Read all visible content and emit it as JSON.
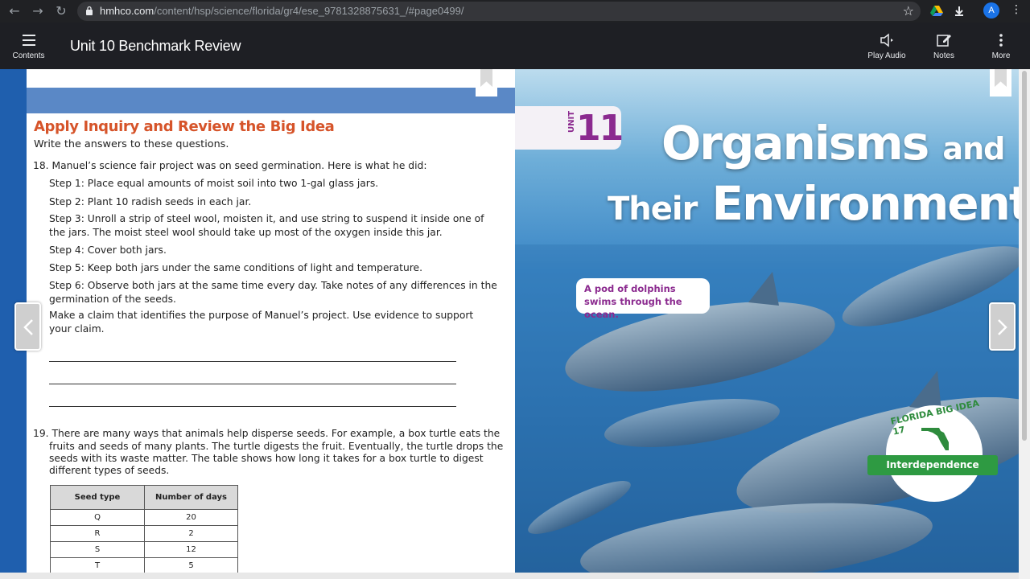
{
  "browser": {
    "url_domain": "hmhco.com",
    "url_path": "/content/hsp/science/florida/gr4/ese_9781328875631_/#page0499/",
    "avatar_letter": "A"
  },
  "header": {
    "contents_label": "Contents",
    "title": "Unit 10 Benchmark Review",
    "play_audio_label": "Play Audio",
    "notes_label": "Notes",
    "more_label": "More"
  },
  "left_page": {
    "section_title": "Apply Inquiry and Review the Big Idea",
    "instructions": "Write the answers to these questions.",
    "q18": {
      "intro": "18. Manuel’s science fair project was on seed germination. Here is what he did:",
      "step1": "Step 1: Place equal amounts of moist soil into two 1-gal glass jars.",
      "step2": "Step 2: Plant 10 radish seeds in each jar.",
      "step3a": "Step 3: Unroll a strip of steel wool, moisten it, and use string to suspend it inside one of",
      "step3b": "the jars. The moist steel wool should take up most of the oxygen inside this jar.",
      "step4": "Step 4: Cover both jars.",
      "step5": "Step 5: Keep both jars under the same conditions of light and temperature.",
      "step6a": "Step 6: Observe both jars at the same time every day. Take notes of any differences in the",
      "step6b": "germination of the seeds.",
      "prompt_a": "Make a claim that identifies the purpose of Manuel’s project. Use evidence to support",
      "prompt_b": "your claim."
    },
    "q19": {
      "line1": "19. There are many ways that animals help disperse seeds. For example, a box turtle eats the",
      "line2": "fruits and seeds of many plants. The turtle digests the fruit. Eventually, the turtle drops the",
      "line3": "seeds with its waste matter. The table shows how long it takes for a box turtle to digest",
      "line4": "different types of seeds."
    },
    "table": {
      "headers": [
        "Seed type",
        "Number of days"
      ],
      "rows": [
        [
          "Q",
          "20"
        ],
        [
          "R",
          "2"
        ],
        [
          "S",
          "12"
        ],
        [
          "T",
          "5"
        ]
      ]
    }
  },
  "right_page": {
    "unit_word": "UNIT",
    "unit_number": "11",
    "title_line1_a": "Organisms",
    "title_line1_b": "and",
    "title_line2_a": "Their",
    "title_line2_b": "Environment",
    "caption": "A pod of dolphins swims through the ocean.",
    "badge_text": "FLORIDA BIG IDEA 17",
    "badge_label": "Interdependence"
  },
  "colors": {
    "section_title": "#d6542a",
    "unit_purple": "#8b2a8f",
    "badge_green": "#2e9a42",
    "stage_blue": "#1f5fae"
  }
}
